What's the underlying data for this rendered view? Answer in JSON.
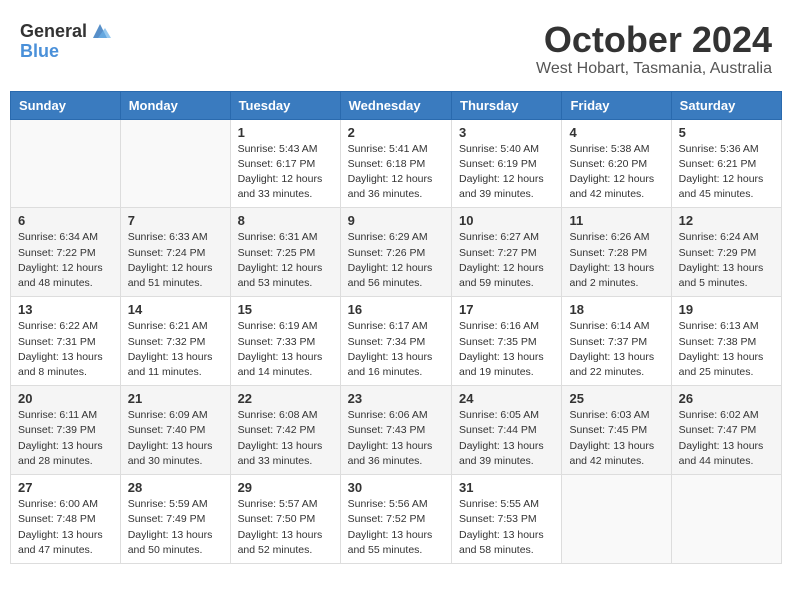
{
  "header": {
    "logo_general": "General",
    "logo_blue": "Blue",
    "month": "October 2024",
    "location": "West Hobart, Tasmania, Australia"
  },
  "days_of_week": [
    "Sunday",
    "Monday",
    "Tuesday",
    "Wednesday",
    "Thursday",
    "Friday",
    "Saturday"
  ],
  "weeks": [
    [
      {
        "day": "",
        "info": ""
      },
      {
        "day": "",
        "info": ""
      },
      {
        "day": "1",
        "info": "Sunrise: 5:43 AM\nSunset: 6:17 PM\nDaylight: 12 hours\nand 33 minutes."
      },
      {
        "day": "2",
        "info": "Sunrise: 5:41 AM\nSunset: 6:18 PM\nDaylight: 12 hours\nand 36 minutes."
      },
      {
        "day": "3",
        "info": "Sunrise: 5:40 AM\nSunset: 6:19 PM\nDaylight: 12 hours\nand 39 minutes."
      },
      {
        "day": "4",
        "info": "Sunrise: 5:38 AM\nSunset: 6:20 PM\nDaylight: 12 hours\nand 42 minutes."
      },
      {
        "day": "5",
        "info": "Sunrise: 5:36 AM\nSunset: 6:21 PM\nDaylight: 12 hours\nand 45 minutes."
      }
    ],
    [
      {
        "day": "6",
        "info": "Sunrise: 6:34 AM\nSunset: 7:22 PM\nDaylight: 12 hours\nand 48 minutes."
      },
      {
        "day": "7",
        "info": "Sunrise: 6:33 AM\nSunset: 7:24 PM\nDaylight: 12 hours\nand 51 minutes."
      },
      {
        "day": "8",
        "info": "Sunrise: 6:31 AM\nSunset: 7:25 PM\nDaylight: 12 hours\nand 53 minutes."
      },
      {
        "day": "9",
        "info": "Sunrise: 6:29 AM\nSunset: 7:26 PM\nDaylight: 12 hours\nand 56 minutes."
      },
      {
        "day": "10",
        "info": "Sunrise: 6:27 AM\nSunset: 7:27 PM\nDaylight: 12 hours\nand 59 minutes."
      },
      {
        "day": "11",
        "info": "Sunrise: 6:26 AM\nSunset: 7:28 PM\nDaylight: 13 hours\nand 2 minutes."
      },
      {
        "day": "12",
        "info": "Sunrise: 6:24 AM\nSunset: 7:29 PM\nDaylight: 13 hours\nand 5 minutes."
      }
    ],
    [
      {
        "day": "13",
        "info": "Sunrise: 6:22 AM\nSunset: 7:31 PM\nDaylight: 13 hours\nand 8 minutes."
      },
      {
        "day": "14",
        "info": "Sunrise: 6:21 AM\nSunset: 7:32 PM\nDaylight: 13 hours\nand 11 minutes."
      },
      {
        "day": "15",
        "info": "Sunrise: 6:19 AM\nSunset: 7:33 PM\nDaylight: 13 hours\nand 14 minutes."
      },
      {
        "day": "16",
        "info": "Sunrise: 6:17 AM\nSunset: 7:34 PM\nDaylight: 13 hours\nand 16 minutes."
      },
      {
        "day": "17",
        "info": "Sunrise: 6:16 AM\nSunset: 7:35 PM\nDaylight: 13 hours\nand 19 minutes."
      },
      {
        "day": "18",
        "info": "Sunrise: 6:14 AM\nSunset: 7:37 PM\nDaylight: 13 hours\nand 22 minutes."
      },
      {
        "day": "19",
        "info": "Sunrise: 6:13 AM\nSunset: 7:38 PM\nDaylight: 13 hours\nand 25 minutes."
      }
    ],
    [
      {
        "day": "20",
        "info": "Sunrise: 6:11 AM\nSunset: 7:39 PM\nDaylight: 13 hours\nand 28 minutes."
      },
      {
        "day": "21",
        "info": "Sunrise: 6:09 AM\nSunset: 7:40 PM\nDaylight: 13 hours\nand 30 minutes."
      },
      {
        "day": "22",
        "info": "Sunrise: 6:08 AM\nSunset: 7:42 PM\nDaylight: 13 hours\nand 33 minutes."
      },
      {
        "day": "23",
        "info": "Sunrise: 6:06 AM\nSunset: 7:43 PM\nDaylight: 13 hours\nand 36 minutes."
      },
      {
        "day": "24",
        "info": "Sunrise: 6:05 AM\nSunset: 7:44 PM\nDaylight: 13 hours\nand 39 minutes."
      },
      {
        "day": "25",
        "info": "Sunrise: 6:03 AM\nSunset: 7:45 PM\nDaylight: 13 hours\nand 42 minutes."
      },
      {
        "day": "26",
        "info": "Sunrise: 6:02 AM\nSunset: 7:47 PM\nDaylight: 13 hours\nand 44 minutes."
      }
    ],
    [
      {
        "day": "27",
        "info": "Sunrise: 6:00 AM\nSunset: 7:48 PM\nDaylight: 13 hours\nand 47 minutes."
      },
      {
        "day": "28",
        "info": "Sunrise: 5:59 AM\nSunset: 7:49 PM\nDaylight: 13 hours\nand 50 minutes."
      },
      {
        "day": "29",
        "info": "Sunrise: 5:57 AM\nSunset: 7:50 PM\nDaylight: 13 hours\nand 52 minutes."
      },
      {
        "day": "30",
        "info": "Sunrise: 5:56 AM\nSunset: 7:52 PM\nDaylight: 13 hours\nand 55 minutes."
      },
      {
        "day": "31",
        "info": "Sunrise: 5:55 AM\nSunset: 7:53 PM\nDaylight: 13 hours\nand 58 minutes."
      },
      {
        "day": "",
        "info": ""
      },
      {
        "day": "",
        "info": ""
      }
    ]
  ]
}
